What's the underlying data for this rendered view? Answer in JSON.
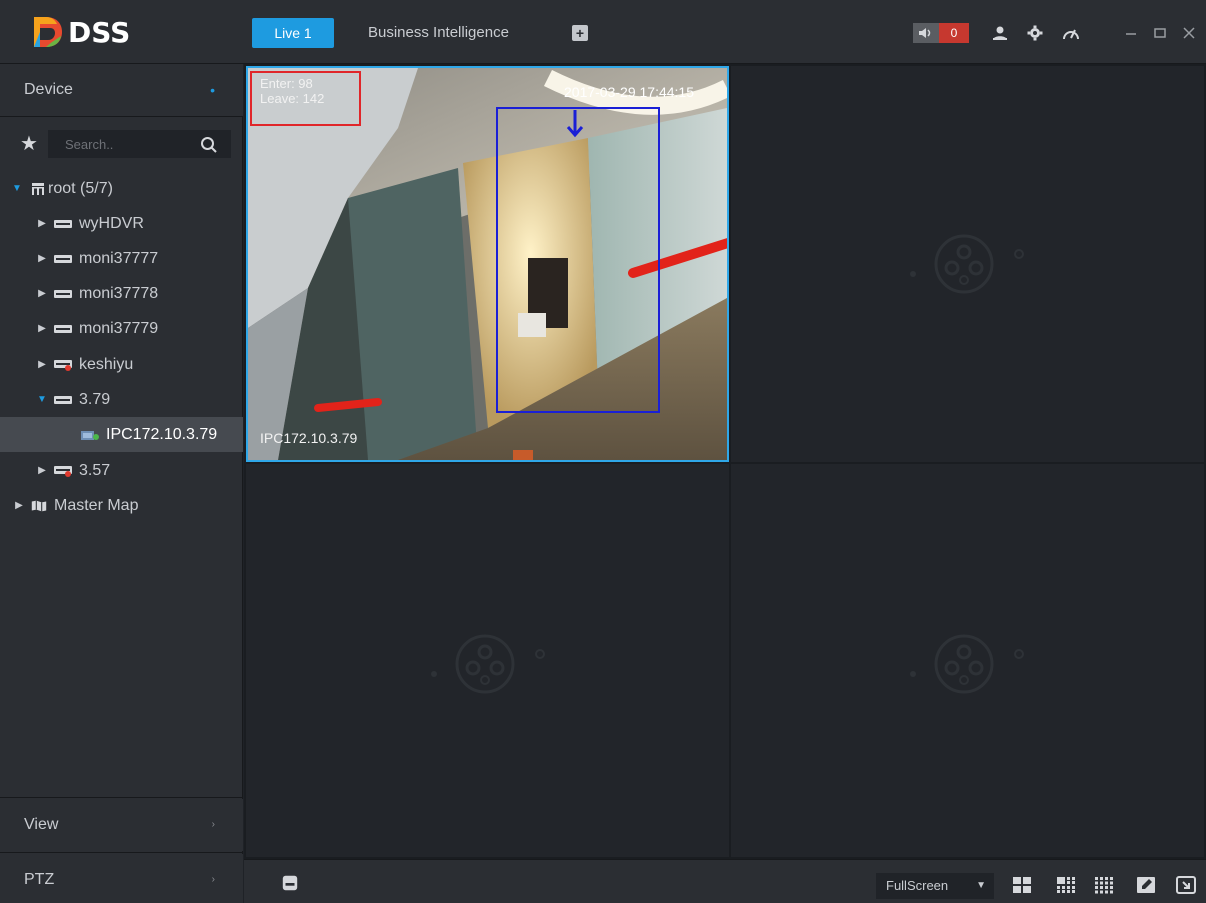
{
  "app": {
    "logo_text": "DSS"
  },
  "tabs": [
    {
      "label": "Live 1"
    },
    {
      "label": "Business Intelligence"
    }
  ],
  "alarm": {
    "count": "0"
  },
  "sidebar": {
    "device_label": "Device",
    "view_label": "View",
    "ptz_label": "PTZ",
    "search_placeholder": "Search..",
    "tree": [
      {
        "label": "root (5/7)"
      },
      {
        "label": "wyHDVR"
      },
      {
        "label": "moni37777"
      },
      {
        "label": "moni37778"
      },
      {
        "label": "moni37779"
      },
      {
        "label": "keshiyu"
      },
      {
        "label": "3.79"
      },
      {
        "label": "IPC172.10.3.79"
      },
      {
        "label": "3.57"
      },
      {
        "label": "Master Map"
      }
    ]
  },
  "feed": {
    "enter_text": "Enter: 98",
    "leave_text": "Leave: 142",
    "timestamp": "2017-03-29 17:44:15",
    "channel_name": "IPC172.10.3.79"
  },
  "bottombar": {
    "fullscreen_label": "FullScreen"
  },
  "colors": {
    "accent": "#1e9be0",
    "alarm": "#c6382f",
    "bg": "#2b2e33"
  }
}
